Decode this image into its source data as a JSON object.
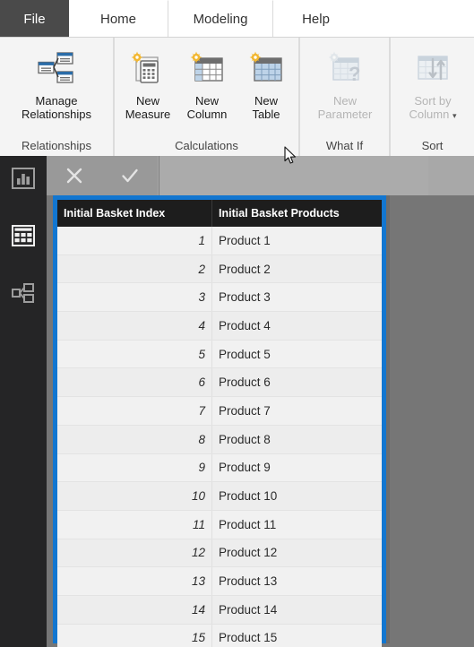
{
  "ribbon": {
    "tabs": [
      {
        "id": "file",
        "label": "File"
      },
      {
        "id": "home",
        "label": "Home"
      },
      {
        "id": "modeling",
        "label": "Modeling"
      },
      {
        "id": "help",
        "label": "Help"
      }
    ],
    "active_tab": "Modeling",
    "groups": [
      {
        "id": "relationships",
        "label": "Relationships",
        "buttons": [
          {
            "label_line1": "Manage",
            "label_line2": "Relationships",
            "icon": "manage-relationships-icon",
            "disabled": false
          }
        ]
      },
      {
        "id": "calculations",
        "label": "Calculations",
        "buttons": [
          {
            "label_line1": "New",
            "label_line2": "Measure",
            "icon": "new-measure-icon",
            "disabled": false
          },
          {
            "label_line1": "New",
            "label_line2": "Column",
            "icon": "new-column-icon",
            "disabled": false
          },
          {
            "label_line1": "New",
            "label_line2": "Table",
            "icon": "new-table-icon",
            "disabled": false
          }
        ]
      },
      {
        "id": "what-if",
        "label": "What If",
        "buttons": [
          {
            "label_line1": "New",
            "label_line2": "Parameter",
            "icon": "new-parameter-icon",
            "disabled": true
          }
        ]
      },
      {
        "id": "sort",
        "label": "Sort",
        "buttons": [
          {
            "label_line1": "Sort by",
            "label_line2": "Column",
            "icon": "sort-by-column-icon",
            "disabled": true,
            "caret": "▾"
          }
        ]
      }
    ]
  },
  "left_nav": {
    "items": [
      {
        "id": "report",
        "icon": "report-view-icon",
        "selected": false
      },
      {
        "id": "data",
        "icon": "data-view-icon",
        "selected": true
      },
      {
        "id": "model",
        "icon": "model-view-icon",
        "selected": false
      }
    ]
  },
  "formula_bar": {
    "cancel_icon": "close-icon",
    "confirm_icon": "checkmark-icon",
    "value": "",
    "placeholder": ""
  },
  "table": {
    "columns": [
      {
        "key": "index",
        "header": "Initial Basket Index",
        "align": "right"
      },
      {
        "key": "product",
        "header": "Initial Basket Products",
        "align": "left"
      }
    ],
    "rows": [
      {
        "index": "1",
        "product": "Product 1"
      },
      {
        "index": "2",
        "product": "Product 2"
      },
      {
        "index": "3",
        "product": "Product 3"
      },
      {
        "index": "4",
        "product": "Product 4"
      },
      {
        "index": "5",
        "product": "Product 5"
      },
      {
        "index": "6",
        "product": "Product 6"
      },
      {
        "index": "7",
        "product": "Product 7"
      },
      {
        "index": "8",
        "product": "Product 8"
      },
      {
        "index": "9",
        "product": "Product 9"
      },
      {
        "index": "10",
        "product": "Product 10"
      },
      {
        "index": "11",
        "product": "Product 11"
      },
      {
        "index": "12",
        "product": "Product 12"
      },
      {
        "index": "13",
        "product": "Product 13"
      },
      {
        "index": "14",
        "product": "Product 14"
      },
      {
        "index": "15",
        "product": "Product 15"
      }
    ]
  },
  "colors": {
    "selection_blue": "#1276d0",
    "file_tab": "#4a4a4a",
    "header_black": "#1d1d1d",
    "canvas_gray": "#767676",
    "formula_gray": "#a8a8a8",
    "nav_dark": "#252526"
  }
}
